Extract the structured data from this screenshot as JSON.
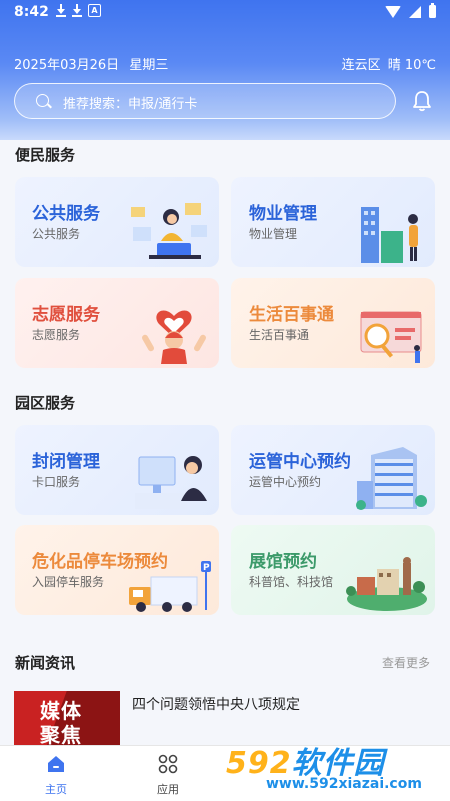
{
  "status_bar": {
    "time": "8:42"
  },
  "header": {
    "date": "2025年03月26日",
    "weekday": "星期三",
    "location": "连云区",
    "weather": "晴 10℃",
    "search_placeholder": "推荐搜索：申报/通行卡"
  },
  "sections": [
    {
      "title": "便民服务",
      "cards": [
        {
          "title": "公共服务",
          "subtitle": "公共服务"
        },
        {
          "title": "物业管理",
          "subtitle": "物业管理"
        },
        {
          "title": "志愿服务",
          "subtitle": "志愿服务"
        },
        {
          "title": "生活百事通",
          "subtitle": "生活百事通"
        }
      ]
    },
    {
      "title": "园区服务",
      "cards": [
        {
          "title": "封闭管理",
          "subtitle": "卡口服务"
        },
        {
          "title": "运管中心预约",
          "subtitle": "运管中心预约"
        },
        {
          "title": "危化品停车场预约",
          "subtitle": "入园停车服务"
        },
        {
          "title": "展馆预约",
          "subtitle": "科普馆、科技馆"
        }
      ]
    }
  ],
  "news": {
    "title": "新闻资讯",
    "more": "查看更多",
    "items": [
      {
        "image_text": "媒体聚焦",
        "title": "四个问题领悟中央八项规定"
      }
    ]
  },
  "tabs": [
    {
      "label": "主页",
      "icon": "home-icon",
      "active": true
    },
    {
      "label": "应用",
      "icon": "grid-icon",
      "active": false
    }
  ],
  "watermark": {
    "big": "592",
    "big_cn": "软件园",
    "small": "www.592xiazai.com"
  },
  "colors": {
    "accent": "#3f74ef",
    "blue_title": "#2b63d9",
    "pink_title": "#e0503e",
    "orange_title": "#ec8a3c",
    "green_title": "#3c9a6a"
  }
}
